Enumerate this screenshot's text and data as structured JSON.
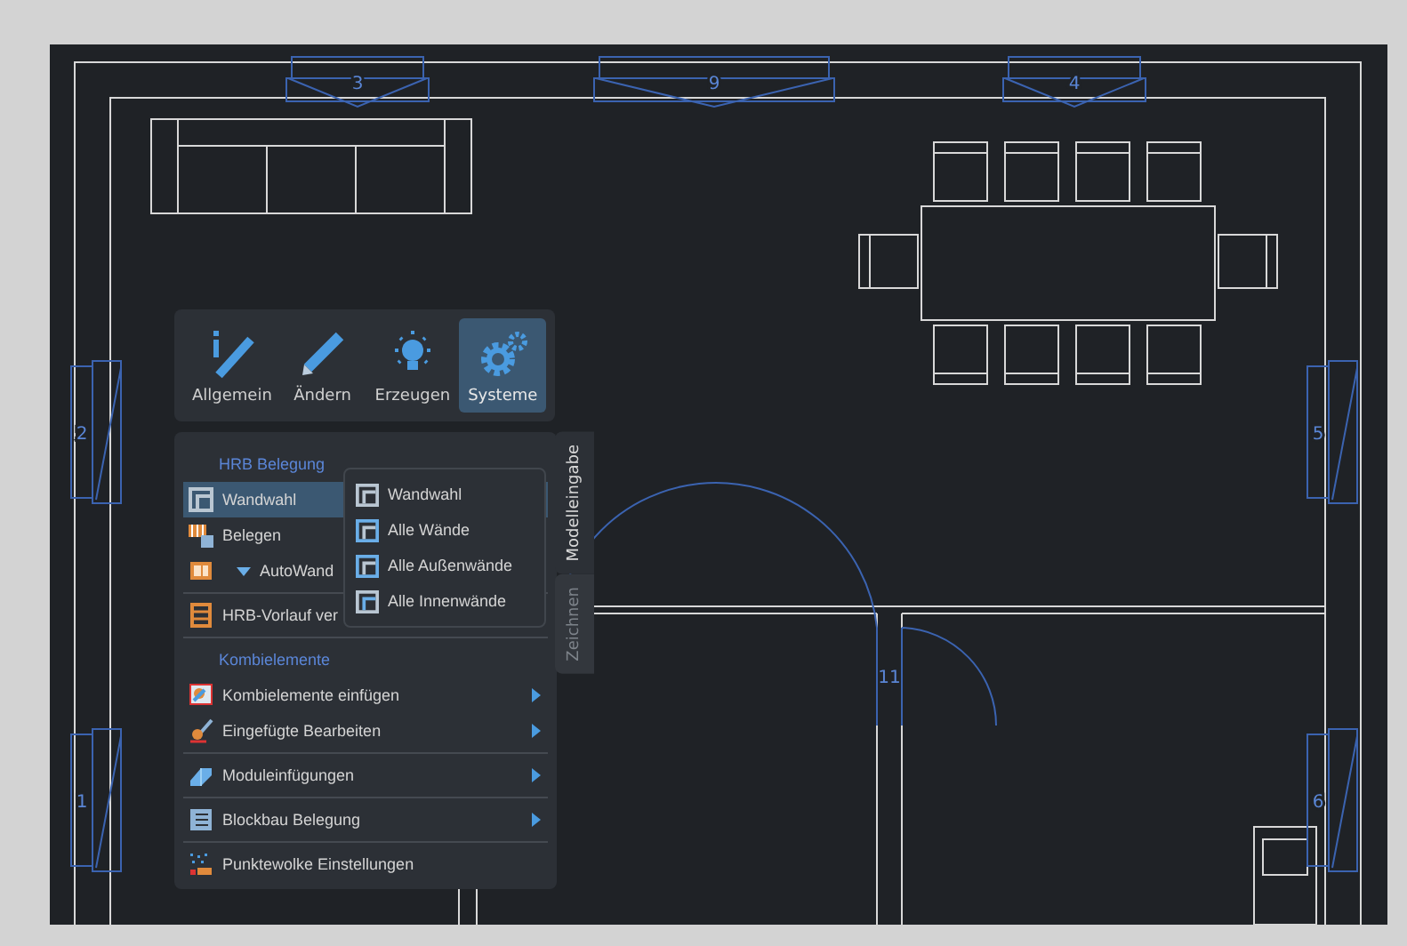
{
  "drawing": {
    "window_numbers": [
      "3",
      "9",
      "4",
      "2",
      "1",
      "5",
      "6"
    ],
    "door_number": "11"
  },
  "ribbon": {
    "tabs": [
      {
        "label": "Allgemein",
        "selected": false
      },
      {
        "label": "Ändern",
        "selected": false
      },
      {
        "label": "Erzeugen",
        "selected": false
      },
      {
        "label": "Systeme",
        "selected": true
      }
    ]
  },
  "menu": {
    "groups": [
      {
        "heading": "HRB Belegung",
        "items": [
          {
            "label": "Wandwahl",
            "selected": true,
            "submenu": false,
            "dropdown": false
          },
          {
            "label": "Belegen",
            "selected": false,
            "submenu": false,
            "dropdown": false
          },
          {
            "label": "AutoWand",
            "selected": false,
            "submenu": false,
            "dropdown": true
          }
        ]
      },
      {
        "items": [
          {
            "label": "HRB-Vorlauf ver",
            "selected": false,
            "submenu": false,
            "dropdown": false
          }
        ]
      },
      {
        "heading": "Kombielemente",
        "items": [
          {
            "label": "Kombielemente einfügen",
            "selected": false,
            "submenu": true,
            "dropdown": false
          },
          {
            "label": "Eingefügte Bearbeiten",
            "selected": false,
            "submenu": true,
            "dropdown": false
          }
        ]
      },
      {
        "items": [
          {
            "label": "Moduleinfügungen",
            "selected": false,
            "submenu": true,
            "dropdown": false
          }
        ]
      },
      {
        "items": [
          {
            "label": "Blockbau Belegung",
            "selected": false,
            "submenu": true,
            "dropdown": false
          }
        ]
      },
      {
        "items": [
          {
            "label": "Punktewolke Einstellungen",
            "selected": false,
            "submenu": false,
            "dropdown": false
          }
        ]
      }
    ]
  },
  "submenu": {
    "items": [
      {
        "label": "Wandwahl"
      },
      {
        "label": "Alle Wände"
      },
      {
        "label": "Alle Außenwände"
      },
      {
        "label": "Alle Innenwände"
      }
    ]
  },
  "side_tabs": [
    {
      "label": "Modelleingabe",
      "selected": true
    },
    {
      "label": "Zeichnen",
      "selected": false
    }
  ]
}
